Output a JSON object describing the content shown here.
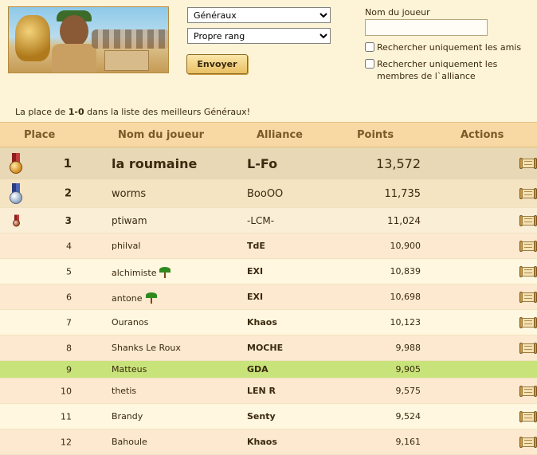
{
  "filters": {
    "category_selected": "Généraux",
    "rank_selected": "Propre rang",
    "send_label": "Envoyer",
    "player_label": "Nom du joueur",
    "player_value": "",
    "only_friends_label": "Rechercher uniquement les amis",
    "only_alliance_label": "Rechercher uniquement les membres de l`alliance"
  },
  "info": {
    "prefix": "La place de ",
    "range": "1-0",
    "suffix": " dans la liste des meilleurs Généraux!"
  },
  "table": {
    "headers": {
      "place": "Place",
      "name": "Nom du joueur",
      "alliance": "Alliance",
      "points": "Points",
      "actions": "Actions"
    },
    "rows": [
      {
        "place": "1",
        "name": "la roumaine",
        "alliance": "L-Fo",
        "points": "13,572"
      },
      {
        "place": "2",
        "name": "worms",
        "alliance": "BooOO",
        "points": "11,735"
      },
      {
        "place": "3",
        "name": "ptiwam",
        "alliance": "-LCM-",
        "points": "11,024"
      },
      {
        "place": "4",
        "name": "philval",
        "alliance": "TdE",
        "points": "10,900"
      },
      {
        "place": "5",
        "name": "alchimiste",
        "alliance": "EXI",
        "points": "10,839"
      },
      {
        "place": "6",
        "name": "antone",
        "alliance": "EXI",
        "points": "10,698"
      },
      {
        "place": "7",
        "name": "Ouranos",
        "alliance": "Khaos",
        "points": "10,123"
      },
      {
        "place": "8",
        "name": "Shanks Le Roux",
        "alliance": "MOCHE",
        "points": "9,988"
      },
      {
        "place": "9",
        "name": "Matteus",
        "alliance": "GDA",
        "points": "9,905"
      },
      {
        "place": "10",
        "name": "thetis",
        "alliance": "LEN R",
        "points": "9,575"
      },
      {
        "place": "11",
        "name": "Brandy",
        "alliance": "Senty",
        "points": "9,524"
      },
      {
        "place": "12",
        "name": "Bahoule",
        "alliance": "Khaos",
        "points": "9,161"
      }
    ]
  },
  "colors": {
    "highlight_row": "#c8e37a",
    "header_bg": "#f9d9a3"
  }
}
